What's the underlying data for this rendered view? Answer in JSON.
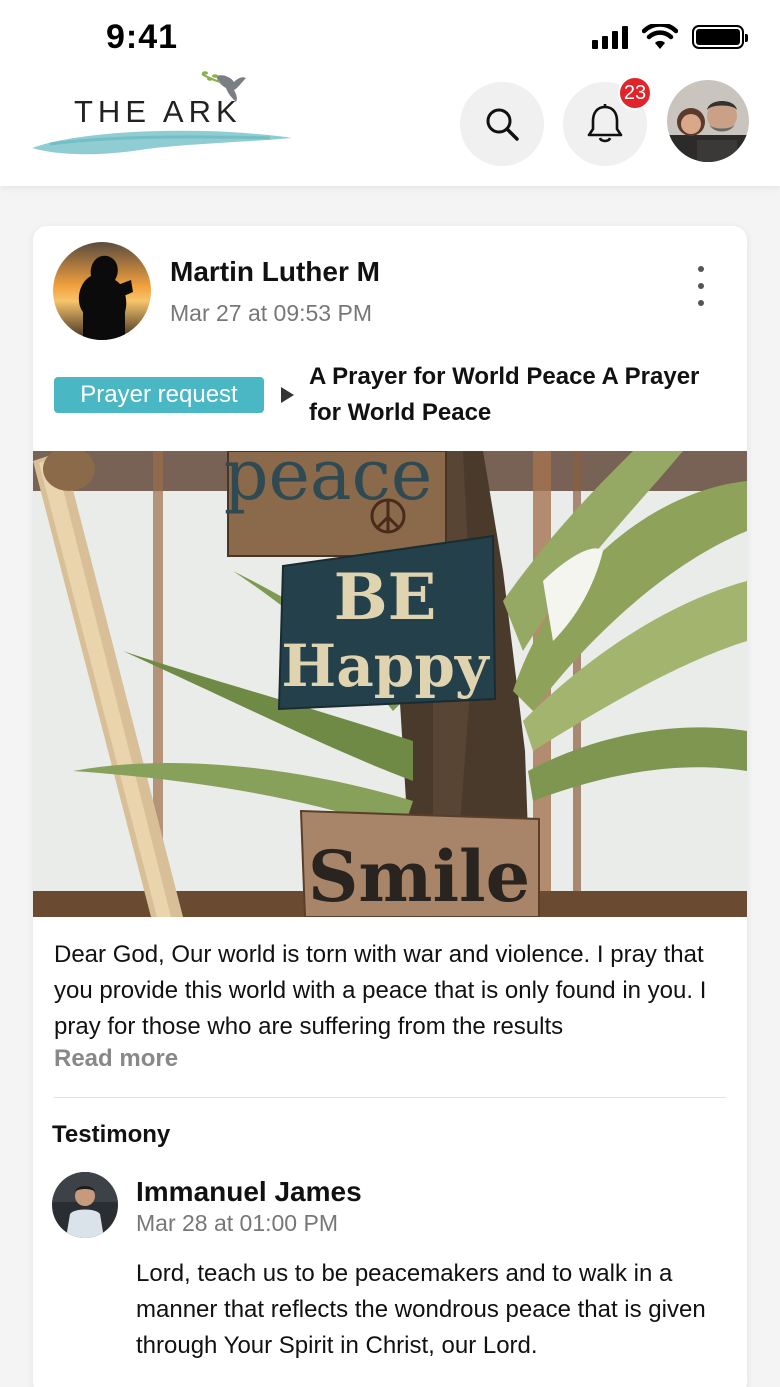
{
  "status_bar": {
    "time": "9:41"
  },
  "header": {
    "logo_text": "THE ARK",
    "notification_count": "23",
    "icons": {
      "search": "search-icon",
      "notifications": "bell-icon"
    }
  },
  "post": {
    "author": "Martin Luther M",
    "date": "Mar 27 at 09:53 PM",
    "category": "Prayer request",
    "title": "A Prayer for World Peace  A Prayer for World Peace",
    "body": "Dear God, Our world is torn with war and violence. I pray that you provide this world with a peace that is only found in you. I pray for those who are suffering from the results",
    "read_more": "Read more",
    "image_signs": [
      "peace",
      "BE",
      "Happy",
      "Smile"
    ]
  },
  "testimony": {
    "section_label": "Testimony",
    "author": "Immanuel James",
    "date": "Mar 28 at 01:00 PM",
    "text": "Lord, teach us to be peacemakers and to walk in a manner that reflects the wondrous peace that is given through Your Spirit in Christ, our Lord."
  },
  "colors": {
    "accent": "#4ab7c4",
    "badge": "#e0242a"
  }
}
